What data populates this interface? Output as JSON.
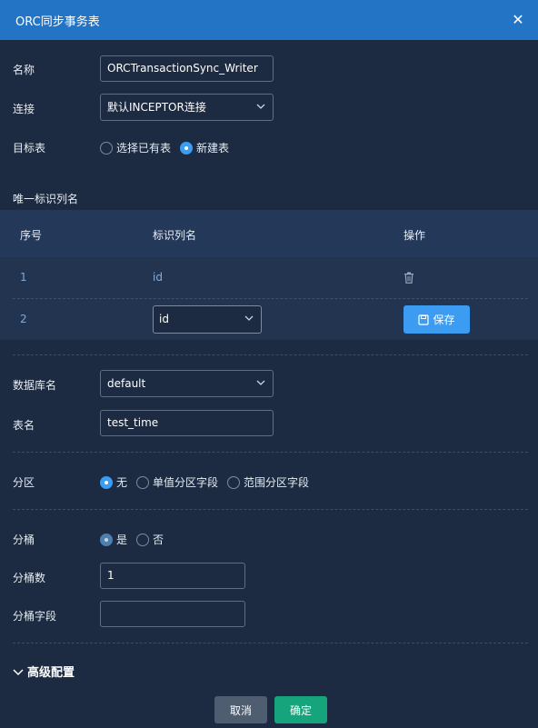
{
  "dialog": {
    "title": "ORC同步事务表"
  },
  "form": {
    "name_label": "名称",
    "name_value": "ORCTransactionSync_Writer",
    "conn_label": "连接",
    "conn_value": "默认INCEPTOR连接",
    "target_label": "目标表",
    "target_options": [
      "选择已有表",
      "新建表"
    ],
    "target_selected": "新建表"
  },
  "unique_section": {
    "title": "唯一标识列名",
    "columns": [
      "序号",
      "标识列名",
      "操作"
    ],
    "rows": [
      {
        "index": "1",
        "column": "id"
      },
      {
        "index": "2",
        "column": "id"
      }
    ],
    "save_label": "保存"
  },
  "db": {
    "db_label": "数据库名",
    "db_value": "default",
    "table_label": "表名",
    "table_value": "test_time"
  },
  "partition": {
    "label": "分区",
    "options": [
      "无",
      "单值分区字段",
      "范围分区字段"
    ],
    "selected": "无"
  },
  "bucket": {
    "label": "分桶",
    "options": [
      "是",
      "否"
    ],
    "selected": "是",
    "count_label": "分桶数",
    "count_value": "1",
    "field_label": "分桶字段",
    "field_value": ""
  },
  "advanced": {
    "label": "高级配置"
  },
  "footer": {
    "cancel_label": "取消",
    "ok_label": "确定"
  },
  "colors": {
    "header": "#2374c4",
    "background": "#1c2b41",
    "primary": "#3b9cf2",
    "confirm": "#16a47c",
    "cancel": "#4e5d70"
  }
}
